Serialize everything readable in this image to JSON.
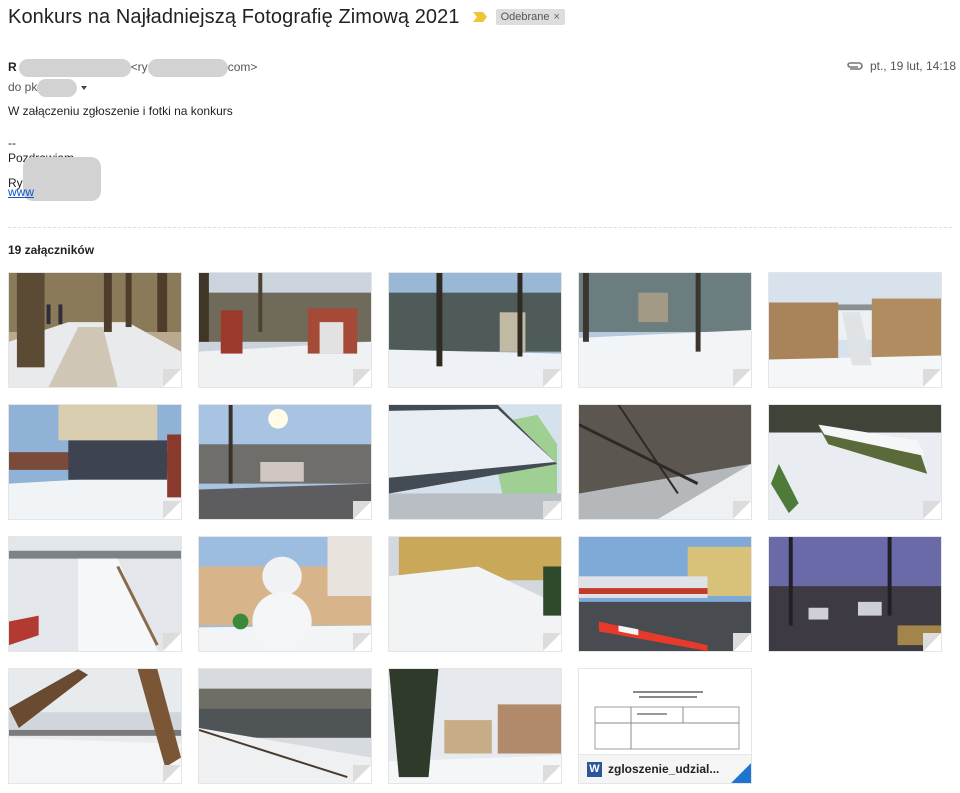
{
  "email": {
    "subject": "Konkurs na Najładniejszą Fotografię Zimową 2021",
    "label": "Odebrane",
    "label_close": "×",
    "sender_initial": "R",
    "sender_email_open": "<ry",
    "sender_email_close": "com>",
    "to_prefix": "do pk",
    "date": "pt., 19 lut, 14:18",
    "body_line1": "W załączeniu zgłoszenie i fotki na konkurs",
    "signature_sep": "--",
    "signature_greeting": "Pozdrawiam,",
    "signature_name_prefix": "Ry",
    "signature_link_prefix": "www",
    "attachments_count_label": "19 załączników",
    "doc_attachment_name": "zgloszenie_udzial...",
    "word_icon_letter": "W"
  },
  "icons": [
    "important-marker-icon",
    "paperclip-icon",
    "dropdown-caret-icon",
    "word-doc-icon"
  ],
  "colors": {
    "label_bg": "#dddddd",
    "important": "#f2c335",
    "link": "#1155cc",
    "word": "#2b579a"
  }
}
